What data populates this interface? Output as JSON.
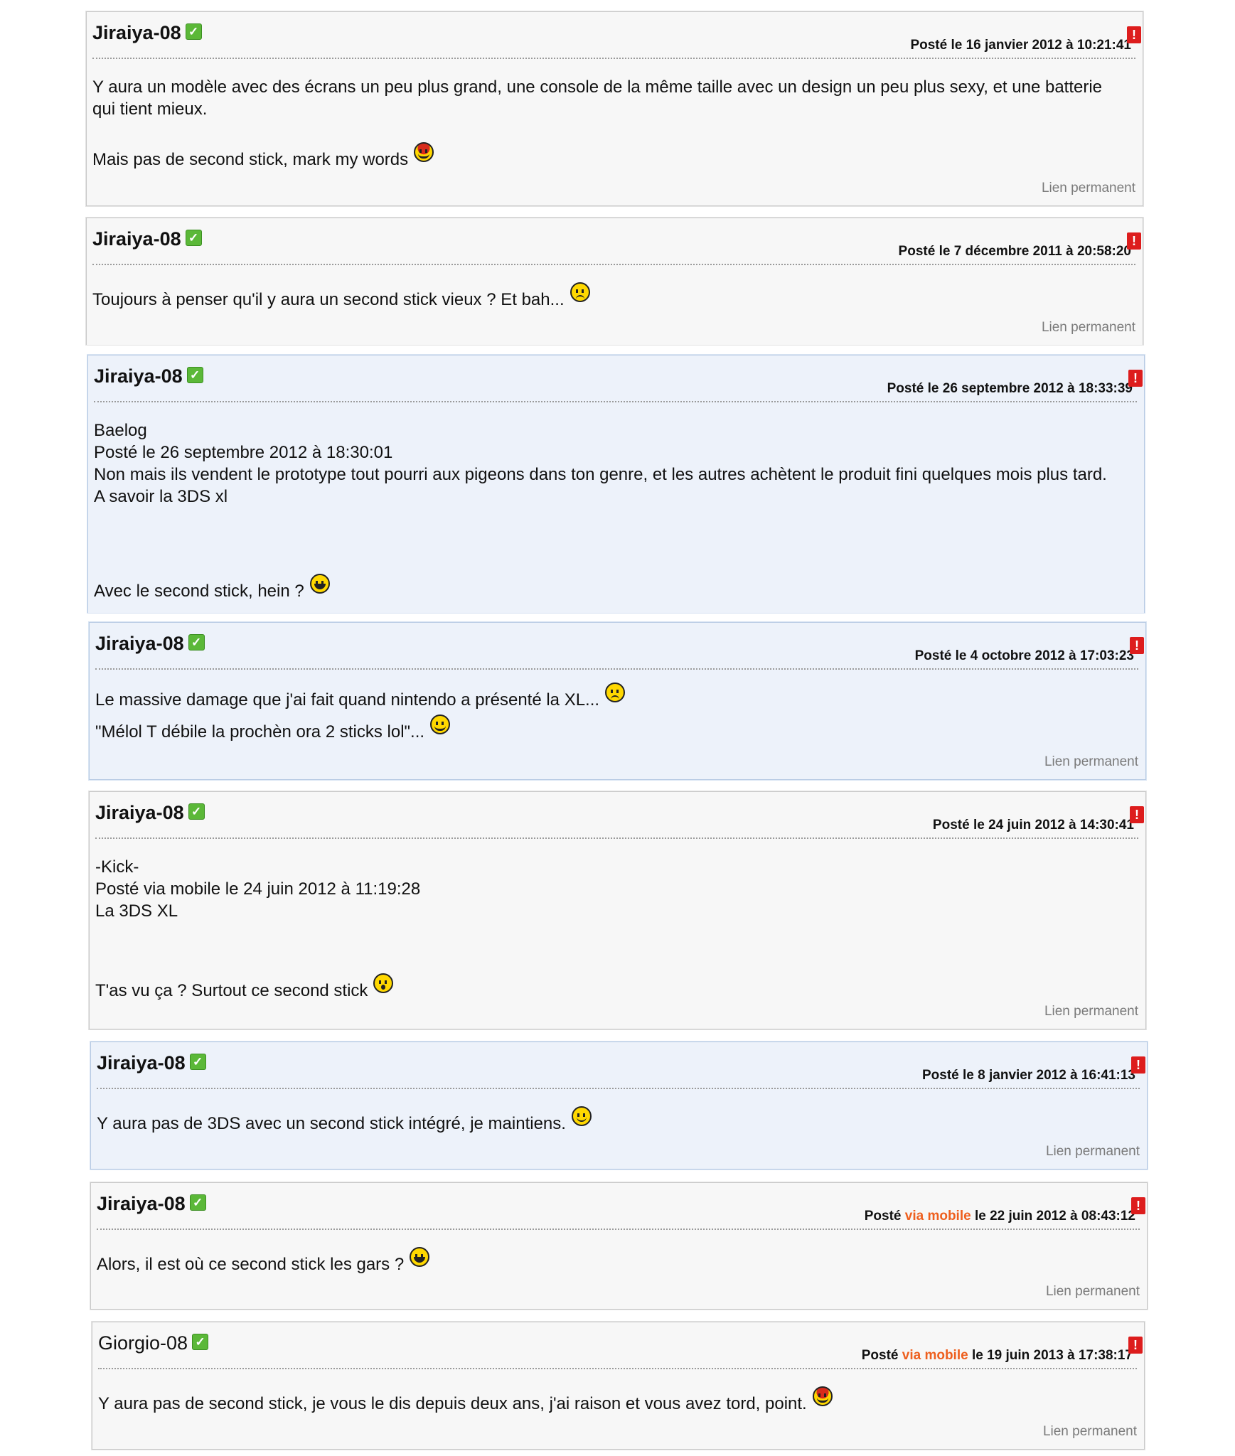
{
  "posts": [
    {
      "author": "Jiraiya-08",
      "badge": "✓",
      "date_prefix": "Posté",
      "date_via": "",
      "date_suffix": "le 16 janvier 2012 à 10:21:41",
      "lines": [
        "Y aura un modèle avec des écrans un peu plus grand, une console de la même taille avec un design un peu plus sexy, et une batterie",
        "qui tient mieux.",
        "Mais pas de second stick, mark my words"
      ],
      "permalink": "Lien permanent"
    },
    {
      "author": "Jiraiya-08",
      "badge": "✓",
      "date_prefix": "Posté",
      "date_via": "",
      "date_suffix": "le 7 décembre 2011 à 20:58:20",
      "lines": [
        "Toujours à penser qu'il y aura un second stick vieux ? Et bah..."
      ],
      "permalink": "Lien permanent"
    },
    {
      "author": "Jiraiya-08",
      "badge": "✓",
      "date_prefix": "Posté",
      "date_via": "",
      "date_suffix": "le 26 septembre 2012 à 18:33:39",
      "lines": [
        "Baelog",
        "Posté le 26 septembre 2012 à 18:30:01",
        "Non mais ils vendent le prototype tout pourri aux pigeons dans ton genre, et les autres achètent le produit fini quelques mois plus tard.",
        "A savoir la 3DS xl",
        "Avec le second stick, hein ?"
      ]
    },
    {
      "author": "Jiraiya-08",
      "badge": "✓",
      "date_prefix": "Posté",
      "date_via": "",
      "date_suffix": "le 4 octobre 2012 à 17:03:23",
      "lines": [
        "Le massive damage que j'ai fait quand nintendo a présenté la XL...",
        "\"Mélol T débile la prochèn ora 2 sticks lol\"..."
      ],
      "permalink": "Lien permanent"
    },
    {
      "author": "Jiraiya-08",
      "badge": "✓",
      "date_prefix": "Posté",
      "date_via": "",
      "date_suffix": "le 24 juin 2012 à 14:30:41",
      "lines": [
        "-Kick-",
        "Posté via mobile le 24 juin 2012 à 11:19:28",
        "La 3DS XL",
        "T'as vu ça ? Surtout ce second stick"
      ],
      "permalink": "Lien permanent"
    },
    {
      "author": "Jiraiya-08",
      "badge": "✓",
      "date_prefix": "Posté",
      "date_via": "",
      "date_suffix": "le 8 janvier 2012 à 16:41:13",
      "lines": [
        "Y aura pas de 3DS avec un second stick intégré, je maintiens."
      ],
      "permalink": "Lien permanent"
    },
    {
      "author": "Jiraiya-08",
      "badge": "✓",
      "date_prefix": "Posté",
      "date_via": "via mobile",
      "date_suffix": "le 22 juin 2012 à 08:43:12",
      "lines": [
        "Alors, il est où ce second stick les gars ?"
      ],
      "permalink": "Lien permanent"
    },
    {
      "author": "Giorgio-08",
      "badge": "✓",
      "date_prefix": "Posté",
      "date_via": "via mobile",
      "date_suffix": "le 19 juin 2013 à 17:38:17",
      "lines": [
        "Y aura pas de second stick, je vous le dis depuis deux ans, j'ai raison et vous avez tord, point."
      ],
      "permalink": "Lien permanent"
    }
  ],
  "icons": {
    "verified": "check-badge-icon",
    "report": "report-alert-icon",
    "cool_smiley": "cool-smiley-icon",
    "sad_smiley": "sad-smiley-icon",
    "laugh_smiley": "laugh-smiley-icon",
    "happy_smiley": "happy-smiley-icon",
    "shock_smiley": "shock-smiley-icon"
  },
  "colors": {
    "highlight_bg": "#edf2fa",
    "mobile_accent": "#ee5f1e",
    "report_red": "#dd1d1d",
    "verified_green": "#5bb838"
  }
}
